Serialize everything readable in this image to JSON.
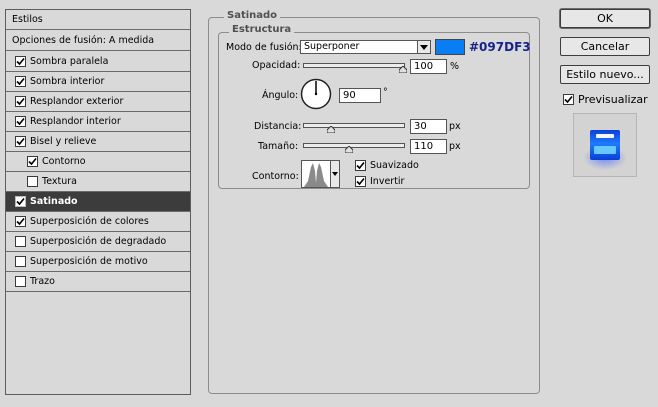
{
  "style_panel": {
    "header": "Estilos",
    "blend_options": "Opciones de fusión: A medida",
    "items": [
      {
        "label": "Sombra paralela",
        "checked": true
      },
      {
        "label": "Sombra interior",
        "checked": true
      },
      {
        "label": "Resplandor exterior",
        "checked": true
      },
      {
        "label": "Resplandor interior",
        "checked": true
      },
      {
        "label": "Bisel y relieve",
        "checked": true
      },
      {
        "label": "Contorno",
        "checked": true
      },
      {
        "label": "Textura",
        "checked": false
      },
      {
        "label": "Satinado",
        "checked": true,
        "selected": true
      },
      {
        "label": "Superposición de colores",
        "checked": true
      },
      {
        "label": "Superposición de degradado",
        "checked": false
      },
      {
        "label": "Superposición de motivo",
        "checked": false
      },
      {
        "label": "Trazo",
        "checked": false
      }
    ]
  },
  "satin": {
    "title": "Satinado",
    "structure_title": "Estructura",
    "blend_mode_label": "Modo de fusión:",
    "blend_mode_value": "Superponer",
    "color_hex": "#097DF3",
    "opacity_label": "Opacidad:",
    "opacity_value": "100",
    "opacity_unit": "%",
    "opacity_fraction": 1.0,
    "angle_label": "Ángulo:",
    "angle_value": "90",
    "angle_unit": "°",
    "distance_label": "Distancia:",
    "distance_value": "30",
    "distance_unit": "px",
    "size_label": "Tamaño:",
    "size_value": "110",
    "size_unit": "px",
    "contour_label": "Contorno:",
    "antialiased_label": "Suavizado",
    "antialiased_checked": true,
    "invert_label": "Invertir",
    "invert_checked": true
  },
  "buttons": {
    "ok": "OK",
    "cancel": "Cancelar",
    "new_style": "Estilo nuevo...",
    "preview_label": "Previsualizar",
    "preview_checked": true
  },
  "colors": {
    "satin_color": "#097DF3",
    "selected_row_bg": "#3c3c3c",
    "hex_text": "#15238a"
  }
}
